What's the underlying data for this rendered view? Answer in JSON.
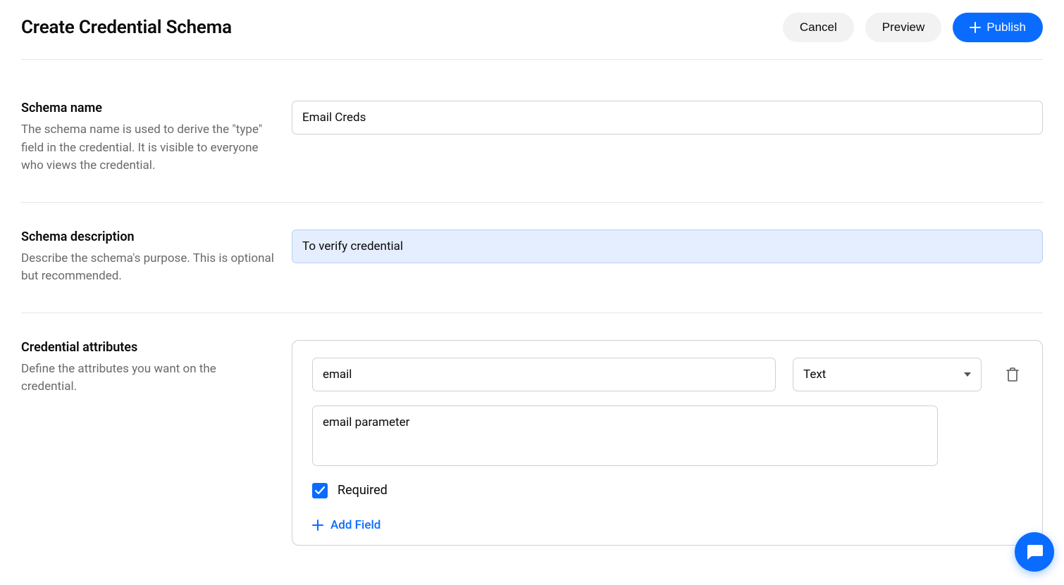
{
  "header": {
    "title": "Create Credential Schema",
    "cancel_label": "Cancel",
    "preview_label": "Preview",
    "publish_label": "Publish"
  },
  "schema_name": {
    "label": "Schema name",
    "description": "The schema name is used to derive the \"type\" field in the credential. It is visible to everyone who views the credential.",
    "value": "Email Creds"
  },
  "schema_description": {
    "label": "Schema description",
    "description": "Describe the schema's purpose. This is optional but recommended.",
    "value": "To verify credential"
  },
  "attributes": {
    "label": "Credential attributes",
    "description": "Define the attributes you want on the credential.",
    "items": [
      {
        "name": "email",
        "type": "Text",
        "desc": "email parameter",
        "required": true,
        "required_label": "Required"
      }
    ],
    "add_field_label": "Add Field"
  }
}
